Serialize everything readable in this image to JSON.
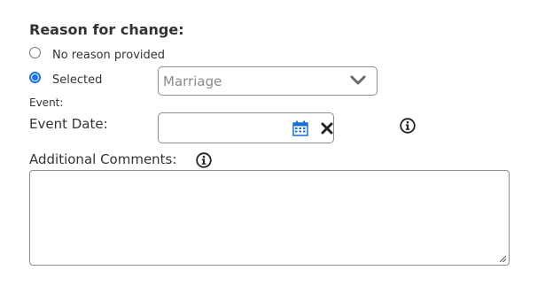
{
  "form": {
    "heading": "Reason for change:",
    "options": [
      {
        "label": "No reason provided",
        "checked": false
      },
      {
        "label": "Selected",
        "checked": true
      }
    ],
    "event_label": "Event:",
    "event_select": {
      "value": "Marriage",
      "icon": "chevron-down-icon"
    },
    "event_date": {
      "label": "Event Date:",
      "value": "",
      "icons": [
        "calendar-icon",
        "clear-icon",
        "info-icon"
      ]
    },
    "comments": {
      "label": "Additional Comments:",
      "value": "",
      "icon": "info-icon"
    }
  },
  "colors": {
    "accent": "#1a73e8",
    "border": "#8c8c8c",
    "text": "#333333",
    "placeholder": "#8a8a8a"
  }
}
